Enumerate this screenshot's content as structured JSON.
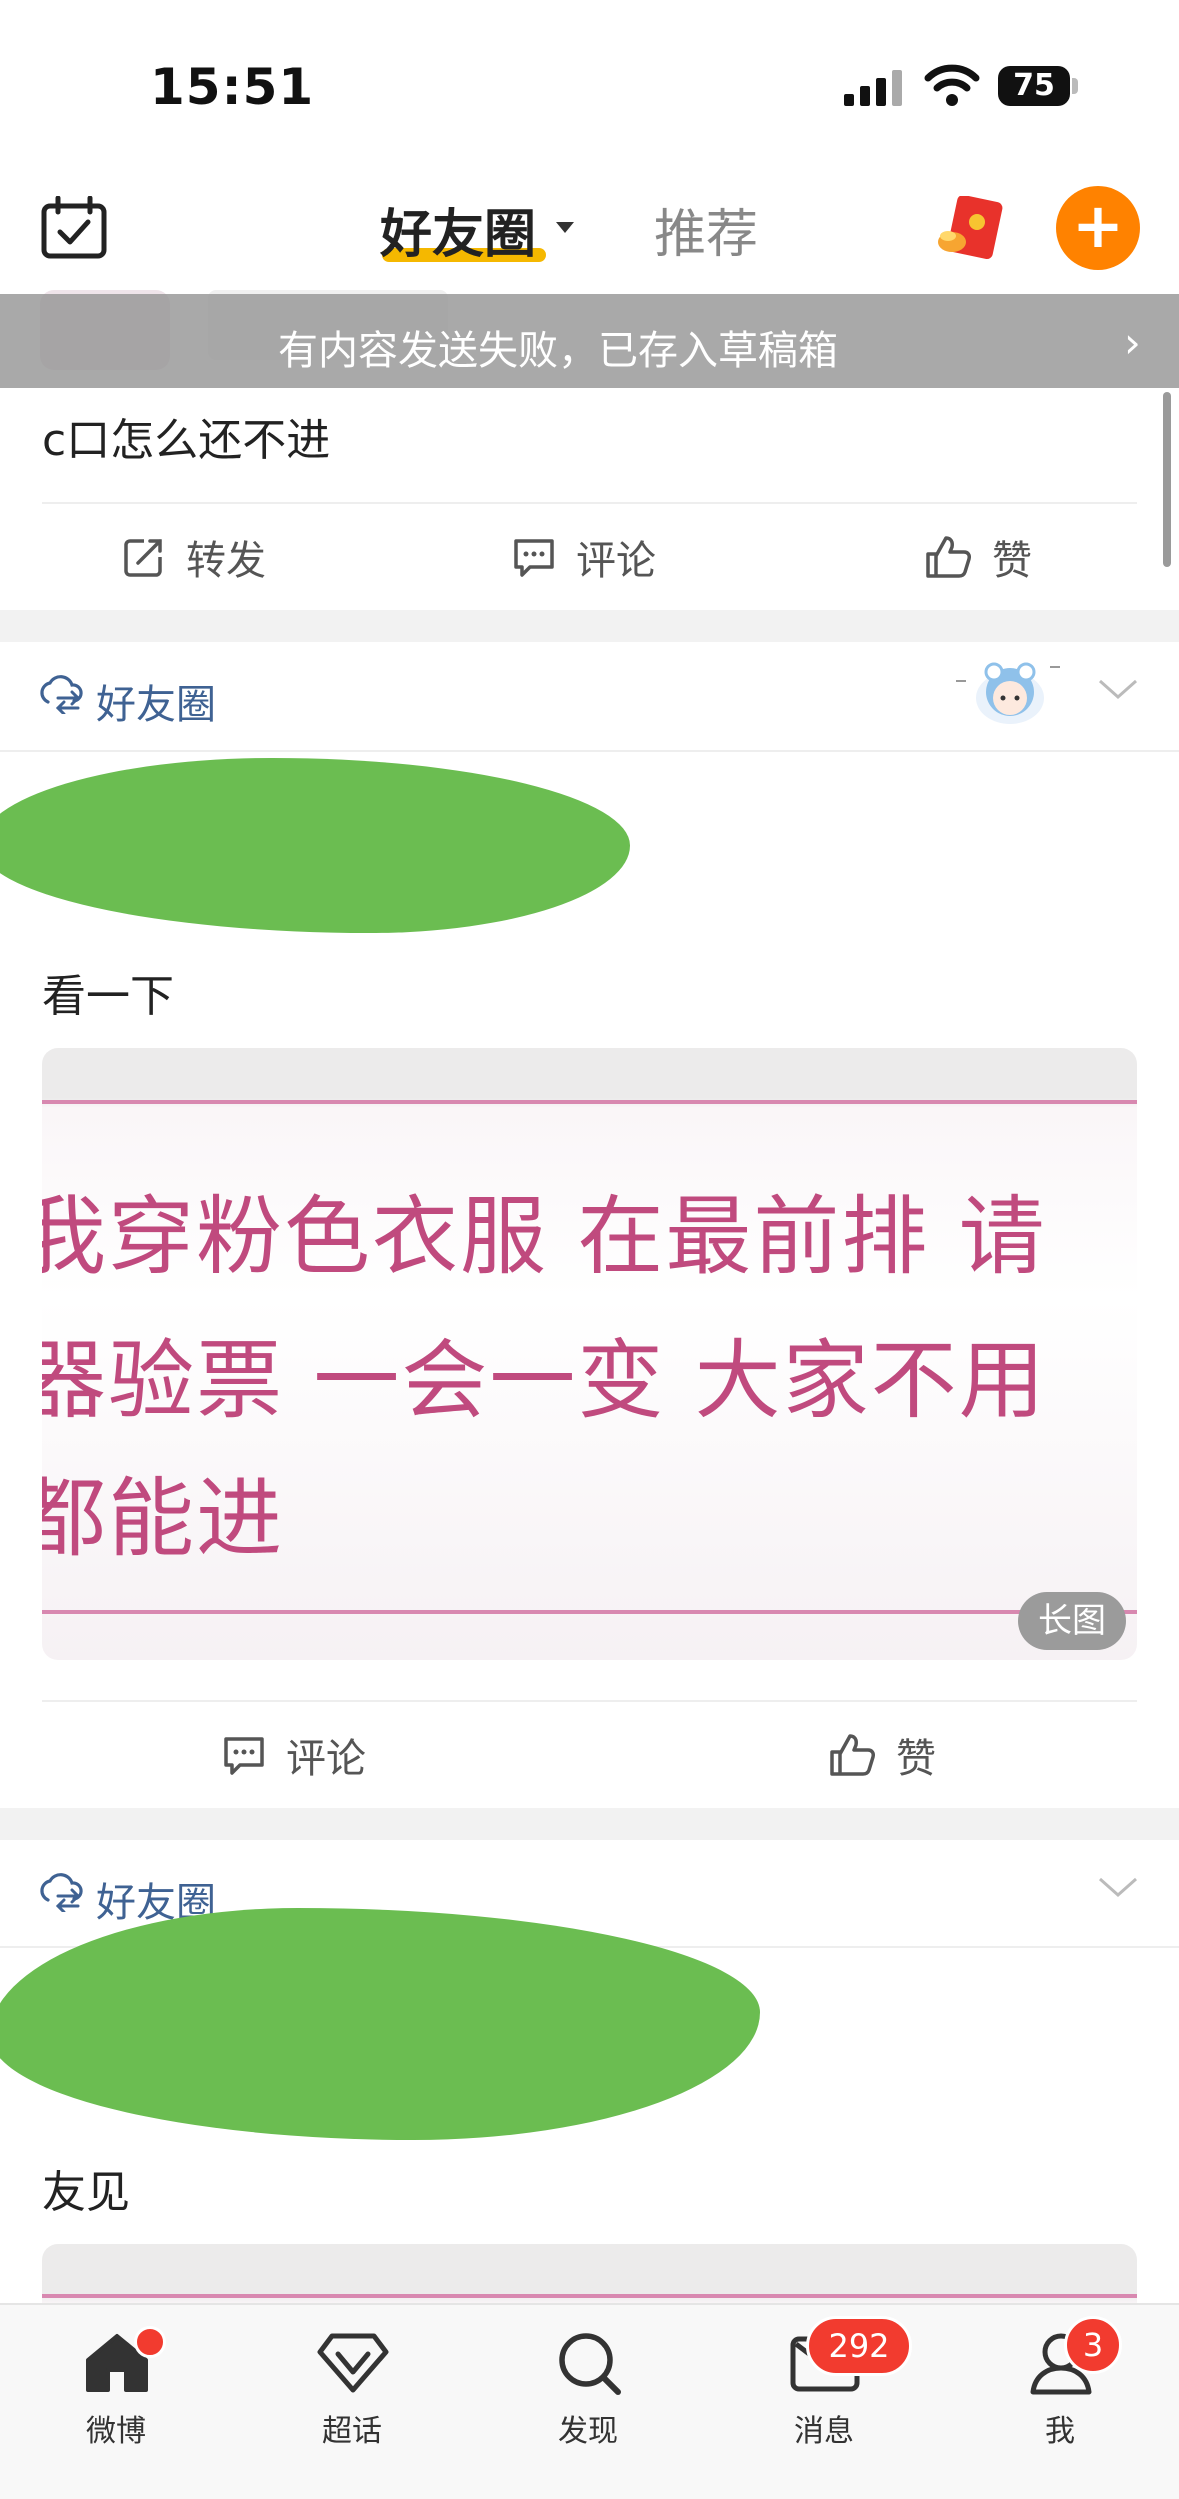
{
  "status_bar": {
    "time": "15:51",
    "battery": "75"
  },
  "top_nav": {
    "active_tab": "好友圈",
    "other_tab": "推荐",
    "plus": "+"
  },
  "toast": {
    "message": "有内容发送失败，已存入草稿箱"
  },
  "post1": {
    "text": "c口怎么还不进",
    "repost_label": "转发",
    "comment_label": "评论",
    "like_label": "赞"
  },
  "post2": {
    "circle_label": "好友圈",
    "text": "看一下",
    "image_lines": [
      "我穿粉色衣服 在最前排 请",
      "器验票 一会一变 大家不用",
      "都能进"
    ],
    "long_image_badge": "长图",
    "comment_label": "评论",
    "like_label": "赞"
  },
  "post3": {
    "circle_label": "好友圈",
    "text": "友见"
  },
  "tab_bar": {
    "items": [
      {
        "label": "微博",
        "icon": "home-icon"
      },
      {
        "label": "超话",
        "icon": "diamond-icon"
      },
      {
        "label": "发现",
        "icon": "search-icon"
      },
      {
        "label": "消息",
        "icon": "mail-icon"
      },
      {
        "label": "我",
        "icon": "profile-icon"
      }
    ],
    "message_badge": "292",
    "me_badge": "3"
  },
  "colors": {
    "brand_orange": "#ff8200",
    "underline_yellow": "#f5b800",
    "badge_red": "#f23b2f",
    "link_blue": "#3f6293"
  }
}
